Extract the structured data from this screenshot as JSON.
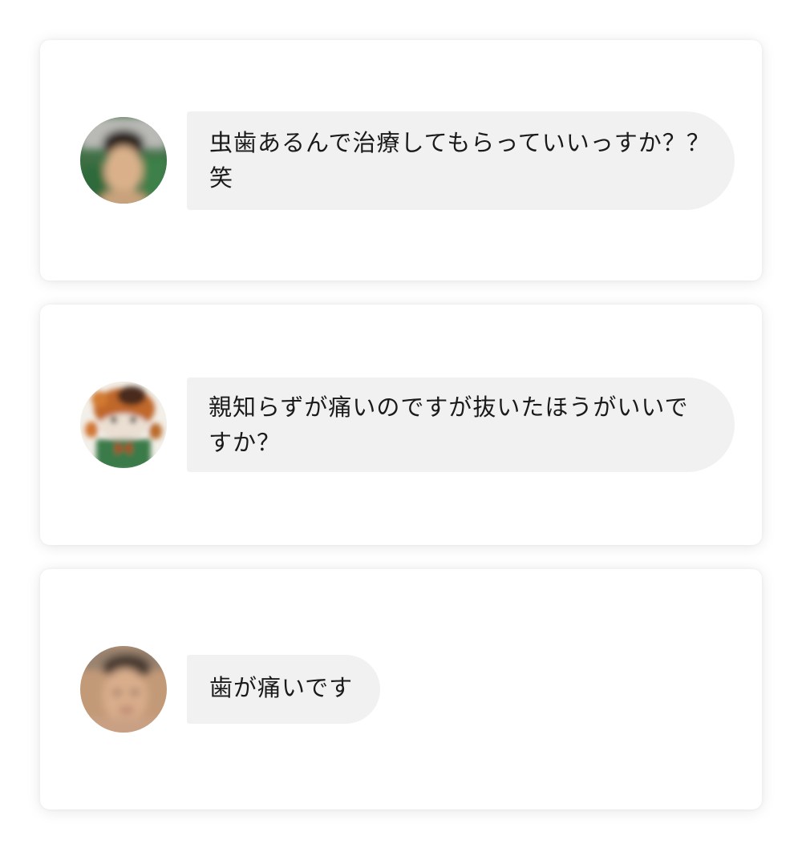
{
  "messages": [
    {
      "avatar_icon": "user-avatar-photo-1",
      "text": "虫歯あるんで治療してもらっていいっすか？？笑"
    },
    {
      "avatar_icon": "mascot-avatar-icon",
      "text": "親知らずが痛いのですが抜いたほうがいいですか？"
    },
    {
      "avatar_icon": "user-avatar-photo-2",
      "text": "歯が痛いです"
    }
  ],
  "colors": {
    "bubble_background": "#f1f1f1",
    "card_background": "#ffffff",
    "text": "#1a1a1a"
  }
}
